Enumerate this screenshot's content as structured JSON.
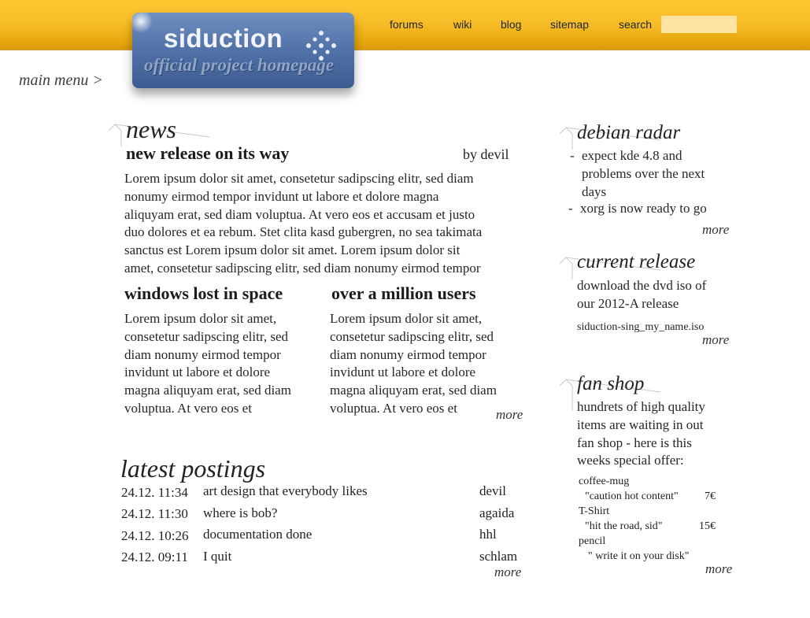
{
  "nav": {
    "forums": "forums",
    "wiki": "wiki",
    "blog": "blog",
    "sitemap": "sitemap",
    "search": "search",
    "search_value": ""
  },
  "logo": {
    "title": "siduction",
    "subtitle": "official project homepage"
  },
  "main_menu": "main menu >",
  "news": {
    "heading": "news",
    "lead": {
      "title": "new release on its way",
      "author": "by devil",
      "lines": [
        "Lorem ipsum dolor sit amet, consetetur sadipscing elitr, sed diam",
        "nonumy eirmod tempor invidunt ut labore et dolore magna",
        "aliquyam erat, sed diam voluptua. At vero eos et accusam et justo",
        "duo dolores et ea rebum. Stet clita kasd gubergren, no sea takimata",
        "sanctus est Lorem ipsum dolor sit amet. Lorem ipsum dolor sit",
        "amet, consetetur sadipscing elitr, sed diam nonumy eirmod tempor"
      ]
    },
    "col1": {
      "title": "windows lost in space",
      "lines": [
        "Lorem ipsum dolor sit amet,",
        "consetetur sadipscing elitr, sed",
        "diam nonumy eirmod tempor",
        "invidunt ut labore et dolore",
        "magna aliquyam erat, sed diam",
        "voluptua. At vero eos et"
      ]
    },
    "col2": {
      "title": "over a million users",
      "lines": [
        "Lorem ipsum dolor sit amet,",
        "consetetur sadipscing elitr, sed",
        "diam nonumy eirmod tempor",
        "invidunt ut labore et dolore",
        "magna aliquyam erat, sed diam",
        "voluptua. At vero eos et"
      ]
    },
    "more": "more"
  },
  "postings": {
    "heading": "latest postings",
    "rows": [
      {
        "time": "24.12. 11:34",
        "title": "art design that everybody likes",
        "user": "devil"
      },
      {
        "time": "24.12. 11:30",
        "title": "where is bob?",
        "user": "agaida"
      },
      {
        "time": "24.12. 10:26",
        "title": "documentation done",
        "user": "hhl"
      },
      {
        "time": "24.12. 09:11",
        "title": "I quit",
        "user": "schlam"
      }
    ],
    "more": "more"
  },
  "radar": {
    "heading": "debian radar",
    "items": [
      {
        "dash": "-",
        "lines": [
          "expect kde 4.8 and",
          "problems over the next",
          "days"
        ]
      },
      {
        "dash": "-",
        "lines": [
          "xorg is now ready to go"
        ]
      }
    ],
    "more": "more"
  },
  "release": {
    "heading": "current release",
    "lines": [
      "download the dvd iso of",
      "our 2012-A release"
    ],
    "file": "siduction-sing_my_name.iso",
    "more": "more"
  },
  "shop": {
    "heading": "fan shop",
    "lines": [
      "hundrets of high quality",
      "items are waiting in out",
      "fan shop - here is this",
      "weeks special offer:"
    ],
    "items": [
      {
        "name": "coffee-mug",
        "desc": "\"caution hot content\"",
        "price": "7€"
      },
      {
        "name": "T-Shirt",
        "desc": "\"hit the road, sid\"",
        "price": "15€"
      },
      {
        "name": "pencil",
        "desc": "\" write it on your disk\"",
        "price": ""
      }
    ],
    "more": "more"
  },
  "colors": {
    "topbar": "#f8be2a",
    "logo_blue": "#4e6fa5",
    "search_field": "#fde3a0"
  },
  "icons": [
    "section-corner-icon",
    "logo-dots-icon"
  ]
}
